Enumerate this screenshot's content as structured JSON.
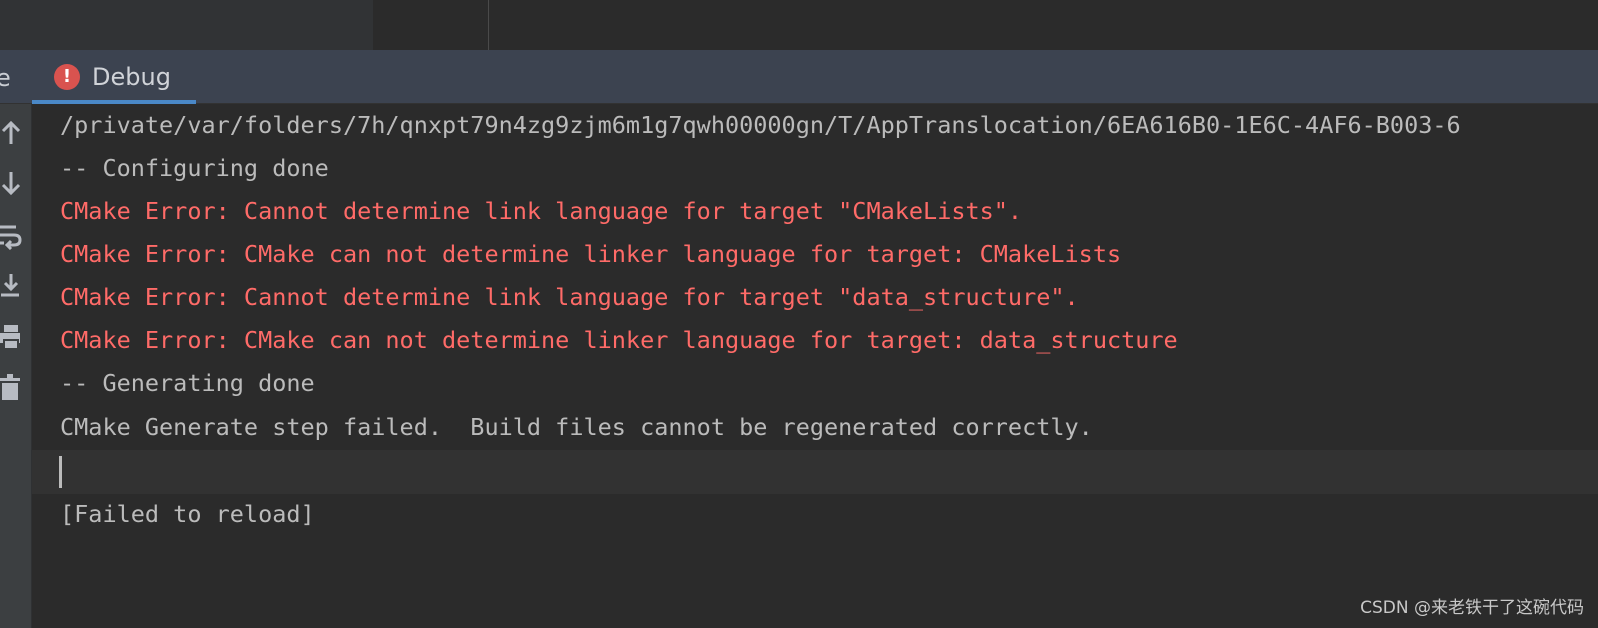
{
  "tabs": {
    "partial_label": "e",
    "debug_label": "Debug",
    "debug_icon": "error-icon"
  },
  "colors": {
    "background": "#2b2b2b",
    "tab_bar": "#3c4350",
    "error_text": "#ff6b68",
    "normal_text": "#bbbbbb",
    "active_tab_underline": "#4a88c7"
  },
  "toolbar": {
    "icons": [
      "up-arrow-icon",
      "down-arrow-icon",
      "soft-wrap-icon",
      "scroll-to-end-icon",
      "print-icon",
      "trash-icon"
    ]
  },
  "console": {
    "lines": [
      {
        "text": "/private/var/folders/7h/qnxpt79n4zg9zjm6m1g7qwh00000gn/T/AppTranslocation/6EA616B0-1E6C-4AF6-B003-6",
        "type": "normal"
      },
      {
        "text": "-- Configuring done",
        "type": "normal"
      },
      {
        "text": "CMake Error: Cannot determine link language for target \"CMakeLists\".",
        "type": "error"
      },
      {
        "text": "CMake Error: CMake can not determine linker language for target: CMakeLists",
        "type": "error"
      },
      {
        "text": "CMake Error: Cannot determine link language for target \"data_structure\".",
        "type": "error"
      },
      {
        "text": "CMake Error: CMake can not determine linker language for target: data_structure",
        "type": "error"
      },
      {
        "text": "-- Generating done",
        "type": "normal"
      },
      {
        "text": "CMake Generate step failed.  Build files cannot be regenerated correctly.",
        "type": "normal"
      },
      {
        "text": "[Failed to reload]",
        "type": "normal"
      }
    ]
  },
  "watermark": "CSDN @来老铁干了这碗代码"
}
